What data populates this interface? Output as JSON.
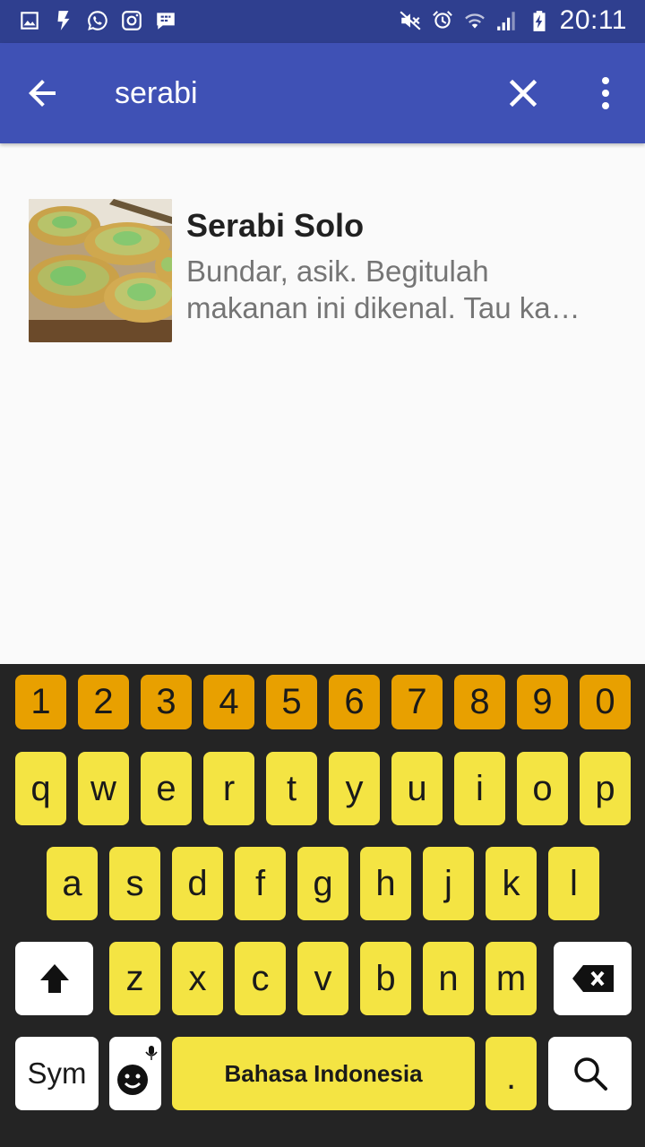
{
  "status_bar": {
    "time": "20:11",
    "left_icons": [
      "gallery-icon",
      "flash-icon",
      "whatsapp-icon",
      "instagram-icon",
      "bbm-icon"
    ],
    "right_icons": [
      "mute-icon",
      "alarm-icon",
      "wifi-icon",
      "signal-icon",
      "battery-charging-icon"
    ]
  },
  "search_bar": {
    "query": "serabi",
    "back_icon": "arrow-back-icon",
    "clear_icon": "close-icon",
    "menu_icon": "more-vert-icon"
  },
  "results": [
    {
      "title": "Serabi Solo",
      "description": "Bundar, asik. Begitulah makanan ini dikenal. Tau ka…",
      "thumbnail": "serabi-food-image"
    }
  ],
  "keyboard": {
    "number_row": [
      "1",
      "2",
      "3",
      "4",
      "5",
      "6",
      "7",
      "8",
      "9",
      "0"
    ],
    "row1": [
      "q",
      "w",
      "e",
      "r",
      "t",
      "y",
      "u",
      "i",
      "o",
      "p"
    ],
    "row2": [
      "a",
      "s",
      "d",
      "f",
      "g",
      "h",
      "j",
      "k",
      "l"
    ],
    "row3": [
      "z",
      "x",
      "c",
      "v",
      "b",
      "n",
      "m"
    ],
    "sym_label": "Sym",
    "space_label": "Bahasa Indonesia",
    "period_label": ".",
    "shift_icon": "shift-icon",
    "backspace_icon": "backspace-icon",
    "emoji_icon": "emoji-mic-icon",
    "search_icon": "search-icon",
    "colors": {
      "number_key": "#e8a000",
      "letter_key": "#f4e443",
      "function_key": "#ffffff",
      "background": "#242424"
    }
  },
  "colors": {
    "status_bar": "#2f3f8f",
    "app_bar": "#3f51b5",
    "background": "#fafafa"
  }
}
